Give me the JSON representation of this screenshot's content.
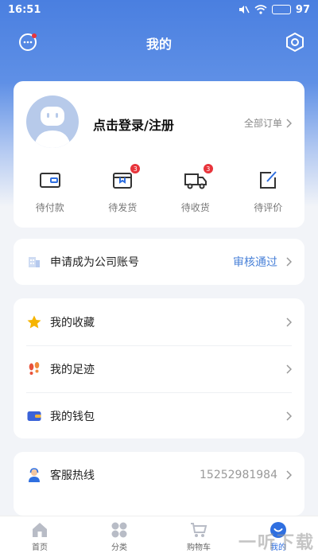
{
  "status_bar": {
    "time": "16:51",
    "battery": "97"
  },
  "header": {
    "title": "我的"
  },
  "profile": {
    "login_text": "点击登录/注册",
    "all_orders_label": "全部订单"
  },
  "orders": [
    {
      "label": "待付款",
      "icon": "wallet-icon",
      "badge": ""
    },
    {
      "label": "待发货",
      "icon": "package-icon",
      "badge": "3"
    },
    {
      "label": "待收货",
      "icon": "truck-icon",
      "badge": "3"
    },
    {
      "label": "待评价",
      "icon": "edit-icon",
      "badge": ""
    }
  ],
  "company": {
    "label": "申请成为公司账号",
    "status": "审核通过"
  },
  "menu": [
    {
      "label": "我的收藏",
      "icon": "star-icon"
    },
    {
      "label": "我的足迹",
      "icon": "footprint-icon"
    },
    {
      "label": "我的钱包",
      "icon": "wallet-icon"
    }
  ],
  "service": {
    "label": "客服热线",
    "phone": "15252981984"
  },
  "tabs": [
    {
      "label": "首页",
      "icon": "home-icon"
    },
    {
      "label": "分类",
      "icon": "category-icon"
    },
    {
      "label": "购物车",
      "icon": "cart-icon"
    },
    {
      "label": "我的",
      "icon": "profile-icon"
    }
  ],
  "watermark": "一听下载",
  "colors": {
    "primary": "#4a7fe0",
    "accent_text": "#4a82d8",
    "badge": "#e8343b"
  }
}
